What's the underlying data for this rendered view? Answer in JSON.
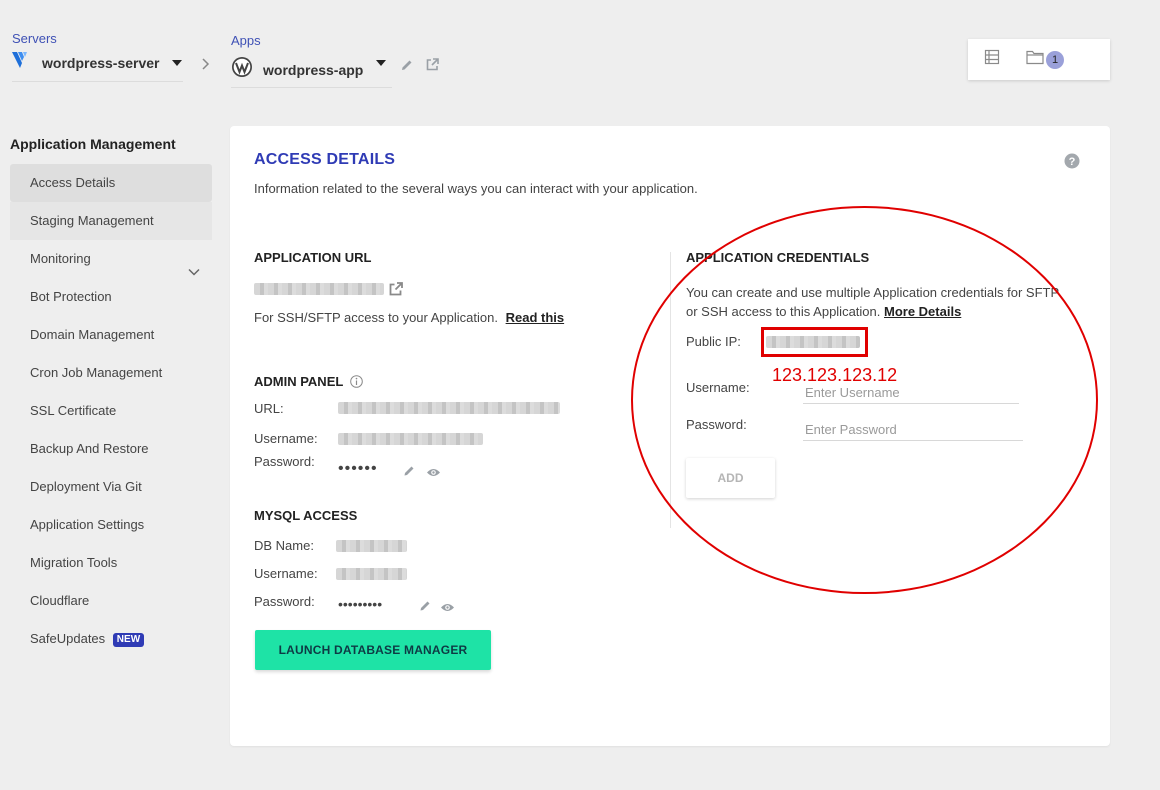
{
  "breadcrumb": {
    "servers_label": "Servers",
    "server_name": "wordpress-server",
    "apps_label": "Apps",
    "app_name": "wordpress-app"
  },
  "top_panel": {
    "notification_count": "1"
  },
  "sidebar": {
    "title": "Application Management",
    "items": [
      {
        "label": "Access Details"
      },
      {
        "label": "Staging Management"
      },
      {
        "label": "Monitoring"
      },
      {
        "label": "Bot Protection"
      },
      {
        "label": "Domain Management"
      },
      {
        "label": "Cron Job Management"
      },
      {
        "label": "SSL Certificate"
      },
      {
        "label": "Backup And Restore"
      },
      {
        "label": "Deployment Via Git"
      },
      {
        "label": "Application Settings"
      },
      {
        "label": "Migration Tools"
      },
      {
        "label": "Cloudflare"
      },
      {
        "label": "SafeUpdates",
        "badge": "NEW"
      }
    ]
  },
  "access": {
    "title": "ACCESS DETAILS",
    "subtitle": "Information related to the several ways you can interact with your application.",
    "app_url": {
      "title": "APPLICATION URL",
      "ssh_text": "For SSH/SFTP access to your Application.",
      "read_this": "Read this"
    },
    "admin": {
      "title": "ADMIN PANEL",
      "url_label": "URL:",
      "username_label": "Username:",
      "password_label": "Password:",
      "password_mask": "••••••"
    },
    "mysql": {
      "title": "MYSQL ACCESS",
      "db_label": "DB Name:",
      "username_label": "Username:",
      "password_label": "Password:",
      "password_mask": "•••••••••",
      "launch_label": "LAUNCH DATABASE MANAGER"
    },
    "credentials": {
      "title": "APPLICATION CREDENTIALS",
      "desc_line1": "You can create and use multiple Application credentials for SFTP",
      "desc_line2": "or SSH access to this Application.",
      "more_details": "More Details",
      "public_ip_label": "Public IP:",
      "username_label": "Username:",
      "username_placeholder": "Enter Username",
      "password_label": "Password:",
      "password_placeholder": "Enter Password",
      "add_label": "ADD"
    }
  },
  "annotation": {
    "text": "123.123.123.12",
    "color": "#e00000"
  },
  "colors": {
    "accent": "#2f3bb5",
    "launch": "#1ee3a6"
  }
}
